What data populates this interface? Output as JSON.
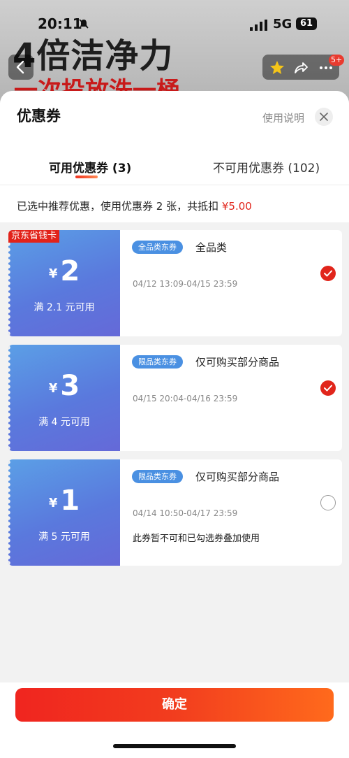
{
  "status_bar": {
    "time": "20:11",
    "network": "5G",
    "battery": "61"
  },
  "background": {
    "title": "4倍洁净力",
    "subtitle": "一次投放洗一桶",
    "cart_badge": "5+"
  },
  "sheet": {
    "title": "优惠券",
    "help_link": "使用说明",
    "tabs": [
      {
        "label": "可用优惠券 (3)",
        "active": true
      },
      {
        "label": "不可用优惠券 (102)",
        "active": false
      }
    ],
    "summary_prefix": "已选中推荐优惠，使用优惠券 2 张，共抵扣 ",
    "summary_amount": "¥5.00"
  },
  "coupons": [
    {
      "corner_tag": "京东省钱卡",
      "currency": "¥",
      "amount": "2",
      "condition": "满 2.1 元可用",
      "type_tag": "全品类东券",
      "scope": "全品类",
      "validity": "04/12 13:09-04/15 23:59",
      "note": "",
      "selected": true
    },
    {
      "corner_tag": "",
      "currency": "¥",
      "amount": "3",
      "condition": "满 4 元可用",
      "type_tag": "限品类东券",
      "scope": "仅可购买部分商品",
      "validity": "04/15 20:04-04/16 23:59",
      "note": "",
      "selected": true
    },
    {
      "corner_tag": "",
      "currency": "¥",
      "amount": "1",
      "condition": "满 5 元可用",
      "type_tag": "限品类东券",
      "scope": "仅可购买部分商品",
      "validity": "04/14 10:50-04/17 23:59",
      "note": "此券暂不可和已勾选券叠加使用",
      "selected": false
    }
  ],
  "footer": {
    "confirm_label": "确定"
  },
  "colors": {
    "accent_red": "#e1251b",
    "coupon_blue": "#5a79dd",
    "tag_blue": "#4a90e2"
  },
  "icons": [
    "back-icon",
    "star-icon",
    "share-icon",
    "more-icon",
    "close-icon",
    "check-icon",
    "bell-muted-icon",
    "signal-icon"
  ]
}
